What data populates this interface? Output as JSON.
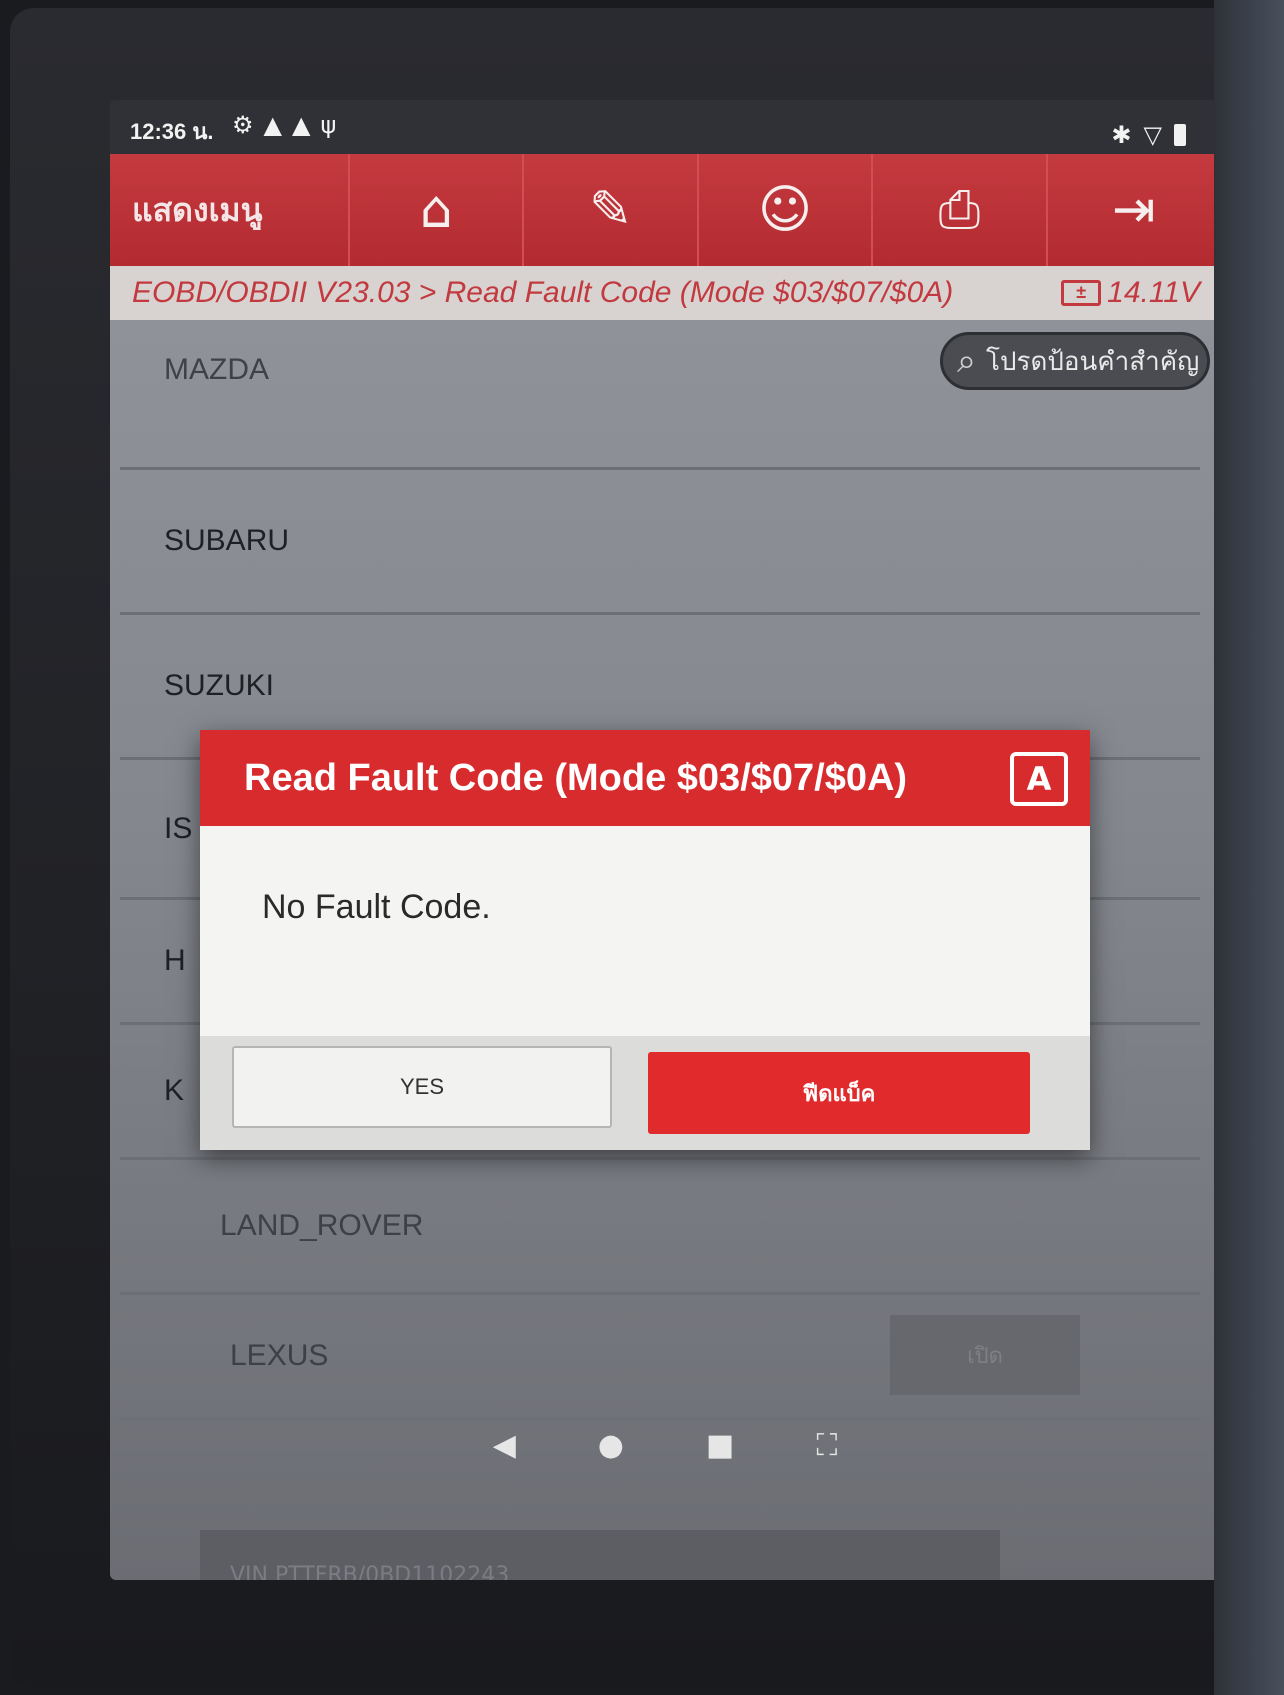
{
  "status_bar": {
    "time": "12:36 น.",
    "left_icons": [
      "settings-badge-icon",
      "warning-icon",
      "warning-icon",
      "usb-debug-icon"
    ],
    "right_icons": [
      "bluetooth-icon",
      "wifi-icon",
      "battery-icon"
    ]
  },
  "toolbar": {
    "menu_label": "แสดงเมนู",
    "buttons": [
      "home-icon",
      "report-edit-icon",
      "support-agent-icon",
      "printer-icon",
      "exit-icon"
    ]
  },
  "breadcrumb": {
    "path": "EOBD/OBDII V23.03 > Read Fault Code (Mode $03/$07/$0A)",
    "voltage": "14.11V"
  },
  "search": {
    "placeholder": "โปรดป้อนคำสำคัญ"
  },
  "list": {
    "items": [
      "MAZDA",
      "SUBARU",
      "SUZUKI",
      "IS",
      "H",
      "K",
      "LAND_ROVER",
      "LEXUS"
    ]
  },
  "bottom": {
    "info": "VIN PTTFRB/0BD1102243",
    "button": "เปิด"
  },
  "dialog": {
    "title": "Read Fault Code (Mode $03/$07/$0A)",
    "message": "No Fault Code.",
    "yes_label": "YES",
    "feedback_label": "ฟีดแบ็ค"
  },
  "colors": {
    "brand_red": "#d72b2e",
    "toolbar_red": "#b32a30"
  }
}
